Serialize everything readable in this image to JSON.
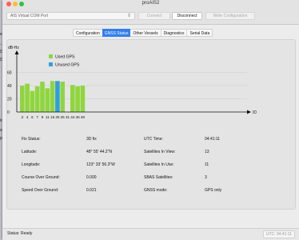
{
  "window": {
    "title": "proAIS2"
  },
  "background_fragments": [
    "enta",
    "...",
    "D...",
    "Dr...",
    "lotes",
    "straft",
    "PDF"
  ],
  "toolbar": {
    "port_select": "AIS Virtual COM Port",
    "connect_label": "Connect",
    "disconnect_label": "Disconnect",
    "write_label": "Write Configuration"
  },
  "tabs": [
    {
      "label": "Configuration",
      "active": false
    },
    {
      "label": "GNSS Status",
      "active": true
    },
    {
      "label": "Other Vessels",
      "active": false
    },
    {
      "label": "Diagnostics",
      "active": false
    },
    {
      "label": "Serial Data",
      "active": false
    }
  ],
  "chart_data": {
    "type": "bar",
    "ylabel": "dB-Hz",
    "xlabel": "ID",
    "y_ticks": [
      "0",
      "20",
      "40",
      "60"
    ],
    "ylim": [
      0,
      85
    ],
    "x_tick_labels": [
      "3",
      "4",
      "6",
      "7",
      "9",
      "11",
      "16",
      "20",
      "25",
      "31",
      "44",
      "46",
      "48"
    ],
    "legend": [
      {
        "name": "Used GPS",
        "color": "#8fd63e"
      },
      {
        "name": "Unused GPS",
        "color": "#2ea0dc"
      }
    ],
    "bars": [
      {
        "id": "3",
        "value": 40,
        "used": true
      },
      {
        "id": "4",
        "value": 43,
        "used": true
      },
      {
        "id": "6",
        "value": 32,
        "used": true
      },
      {
        "id": "7",
        "value": 39,
        "used": true
      },
      {
        "id": "9",
        "value": 46,
        "used": true
      },
      {
        "id": "11",
        "value": 36,
        "used": true
      },
      {
        "id": "16",
        "value": 47,
        "used": true
      },
      {
        "id": "20",
        "value": 47,
        "used": false
      },
      {
        "id": "25",
        "value": 46,
        "used": true
      },
      {
        "id": "31",
        "value": 0,
        "used": true
      },
      {
        "id": "44",
        "value": 41,
        "used": true
      },
      {
        "id": "46",
        "value": 39,
        "used": true
      },
      {
        "id": "48",
        "value": 40,
        "used": true
      }
    ]
  },
  "status_info": {
    "fix_status_label": "Fix Status:",
    "fix_status_value": "3D fix",
    "latitude_label": "Latitude:",
    "latitude_value": "48° 55' 44.2\"N",
    "longitude_label": "Longitude:",
    "longitude_value": "123° 33' 56.3\"W",
    "cog_label": "Course Over Ground:",
    "cog_value": "0.000",
    "sog_label": "Speed Over Ground:",
    "sog_value": "0.021",
    "utc_label": "UTC Time:",
    "utc_value": "04:41:11",
    "sat_view_label": "Satellites In View:",
    "sat_view_value": "13",
    "sat_use_label": "Satellites In Use:",
    "sat_use_value": "11",
    "sbas_label": "SBAS Satellites:",
    "sbas_value": "3",
    "gnss_mode_label": "GNSS mode:",
    "gnss_mode_value": "GPS only"
  },
  "statusbar": {
    "text": "Status: Ready",
    "utc": "UTC: 04:41:11"
  },
  "colors": {
    "accent": "#2f7ef5",
    "used": "#8fd63e",
    "unused": "#2ea0dc"
  }
}
